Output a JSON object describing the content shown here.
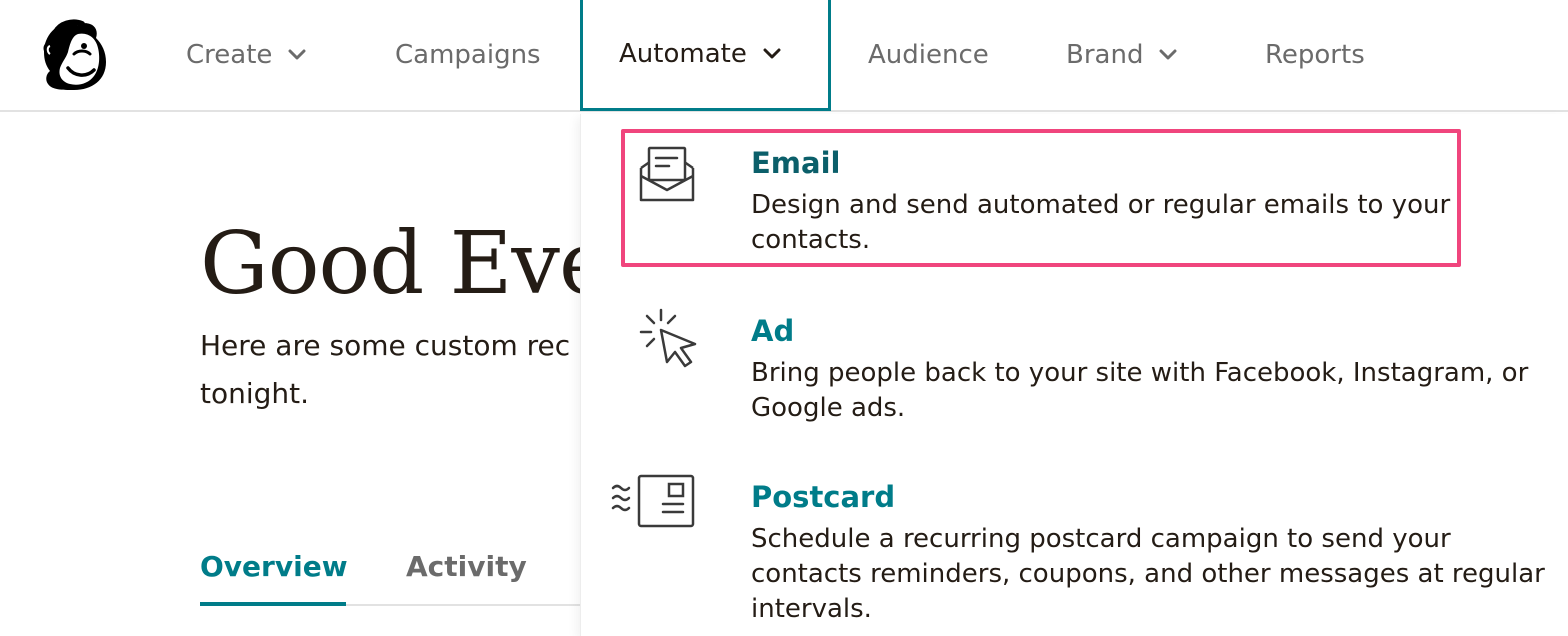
{
  "nav": {
    "items": [
      {
        "label": "Create",
        "has_dropdown": true
      },
      {
        "label": "Campaigns",
        "has_dropdown": false
      },
      {
        "label": "Automate",
        "has_dropdown": true,
        "active": true
      },
      {
        "label": "Audience",
        "has_dropdown": false
      },
      {
        "label": "Brand",
        "has_dropdown": true
      },
      {
        "label": "Reports",
        "has_dropdown": false
      }
    ]
  },
  "main": {
    "greeting": "Good Eve",
    "subtext": "Here are some custom rec done tonight.",
    "tabs": [
      {
        "label": "Overview",
        "active": true
      },
      {
        "label": "Activity",
        "active": false
      }
    ]
  },
  "dropdown": {
    "items": [
      {
        "icon": "envelope-icon",
        "title": "Email",
        "description": "Design and send automated or regular emails to your contacts.",
        "highlighted": true
      },
      {
        "icon": "cursor-click-icon",
        "title": "Ad",
        "description": "Bring people back to your site with Facebook, Instagram, or Google ads."
      },
      {
        "icon": "postcard-icon",
        "title": "Postcard",
        "description": "Schedule a recurring postcard campaign to send your contacts reminders, coupons, and other messages at regular intervals."
      }
    ]
  },
  "colors": {
    "accent": "#007c89",
    "highlight": "#f0457d",
    "text": "#241c15",
    "muted": "#6b6b6b"
  }
}
